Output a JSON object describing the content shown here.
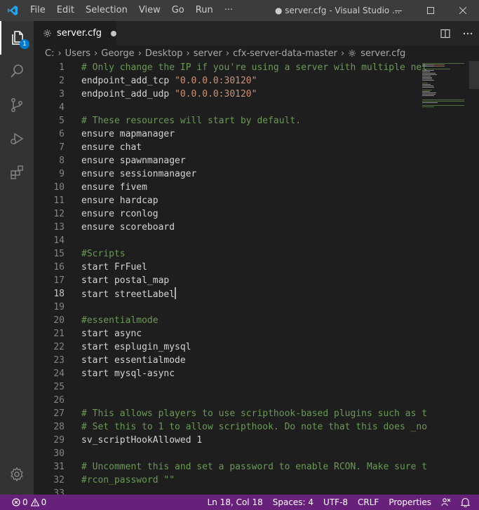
{
  "titlebar": {
    "menu": [
      "File",
      "Edit",
      "Selection",
      "View",
      "Go",
      "Run",
      "···"
    ],
    "title": "● server.cfg - Visual Studio ...",
    "controls": [
      "minimize-icon",
      "maximize-icon",
      "close-icon"
    ]
  },
  "activitybar": {
    "items": [
      "explorer-icon",
      "search-icon",
      "source-control-icon",
      "run-debug-icon",
      "extensions-icon"
    ],
    "explorer_badge": "1",
    "bottom": "manage-gear-icon"
  },
  "tab": {
    "label": "server.cfg",
    "modified_indicator": "dot"
  },
  "breadcrumb": [
    "C:",
    "Users",
    "George",
    "Desktop",
    "server",
    "cfx-server-data-master",
    "server.cfg"
  ],
  "editor": {
    "active_line": 18,
    "lines": [
      {
        "n": "1",
        "parts": [
          {
            "t": "# Only change the IP if you're using a server with multiple net",
            "c": "cmt"
          }
        ]
      },
      {
        "n": "2",
        "parts": [
          {
            "t": "endpoint_add_tcp ",
            "c": ""
          },
          {
            "t": "\"0.0.0.0:30120\"",
            "c": "str"
          }
        ]
      },
      {
        "n": "3",
        "parts": [
          {
            "t": "endpoint_add_udp ",
            "c": ""
          },
          {
            "t": "\"0.0.0.0:30120\"",
            "c": "str"
          }
        ]
      },
      {
        "n": "4",
        "parts": []
      },
      {
        "n": "5",
        "parts": [
          {
            "t": "# These resources will start by default.",
            "c": "cmt"
          }
        ]
      },
      {
        "n": "6",
        "parts": [
          {
            "t": "ensure mapmanager",
            "c": ""
          }
        ]
      },
      {
        "n": "7",
        "parts": [
          {
            "t": "ensure chat",
            "c": ""
          }
        ]
      },
      {
        "n": "8",
        "parts": [
          {
            "t": "ensure spawnmanager",
            "c": ""
          }
        ]
      },
      {
        "n": "9",
        "parts": [
          {
            "t": "ensure sessionmanager",
            "c": ""
          }
        ]
      },
      {
        "n": "10",
        "parts": [
          {
            "t": "ensure fivem",
            "c": ""
          }
        ]
      },
      {
        "n": "11",
        "parts": [
          {
            "t": "ensure hardcap",
            "c": ""
          }
        ]
      },
      {
        "n": "12",
        "parts": [
          {
            "t": "ensure rconlog",
            "c": ""
          }
        ]
      },
      {
        "n": "13",
        "parts": [
          {
            "t": "ensure scoreboard",
            "c": ""
          }
        ]
      },
      {
        "n": "14",
        "parts": []
      },
      {
        "n": "15",
        "parts": [
          {
            "t": "#Scripts",
            "c": "cmt"
          }
        ]
      },
      {
        "n": "16",
        "parts": [
          {
            "t": "start FrFuel",
            "c": ""
          }
        ]
      },
      {
        "n": "17",
        "parts": [
          {
            "t": "start postal_map",
            "c": ""
          }
        ]
      },
      {
        "n": "18",
        "parts": [
          {
            "t": "start streetLabel",
            "c": ""
          }
        ],
        "cursor": true
      },
      {
        "n": "19",
        "parts": []
      },
      {
        "n": "20",
        "parts": [
          {
            "t": "#essentialmode",
            "c": "cmt"
          }
        ]
      },
      {
        "n": "21",
        "parts": [
          {
            "t": "start async",
            "c": ""
          }
        ]
      },
      {
        "n": "22",
        "parts": [
          {
            "t": "start esplugin_mysql",
            "c": ""
          }
        ]
      },
      {
        "n": "23",
        "parts": [
          {
            "t": "start essentialmode",
            "c": ""
          }
        ]
      },
      {
        "n": "24",
        "parts": [
          {
            "t": "start mysql-async",
            "c": ""
          }
        ]
      },
      {
        "n": "25",
        "parts": []
      },
      {
        "n": "26",
        "parts": []
      },
      {
        "n": "27",
        "parts": [
          {
            "t": "# This allows players to use scripthook-based plugins such as t",
            "c": "cmt"
          }
        ]
      },
      {
        "n": "28",
        "parts": [
          {
            "t": "# Set this to 1 to allow scripthook. Do note that this does _no",
            "c": "cmt"
          }
        ]
      },
      {
        "n": "29",
        "parts": [
          {
            "t": "sv_scriptHookAllowed 1",
            "c": ""
          }
        ]
      },
      {
        "n": "30",
        "parts": []
      },
      {
        "n": "31",
        "parts": [
          {
            "t": "# Uncomment this and set a password to enable RCON. Make sure t",
            "c": "cmt"
          }
        ]
      },
      {
        "n": "32",
        "parts": [
          {
            "t": "#rcon_password \"\"",
            "c": "cmt"
          }
        ]
      },
      {
        "n": "33",
        "parts": []
      }
    ]
  },
  "statusbar": {
    "errors": "0",
    "warnings": "0",
    "position": "Ln 18, Col 18",
    "spaces": "Spaces: 4",
    "encoding": "UTF-8",
    "eol": "CRLF",
    "language": "Properties"
  },
  "colors": {
    "statusbar": "#68217a",
    "comment": "#6a9955",
    "string": "#ce9178",
    "accent": "#007acc"
  }
}
